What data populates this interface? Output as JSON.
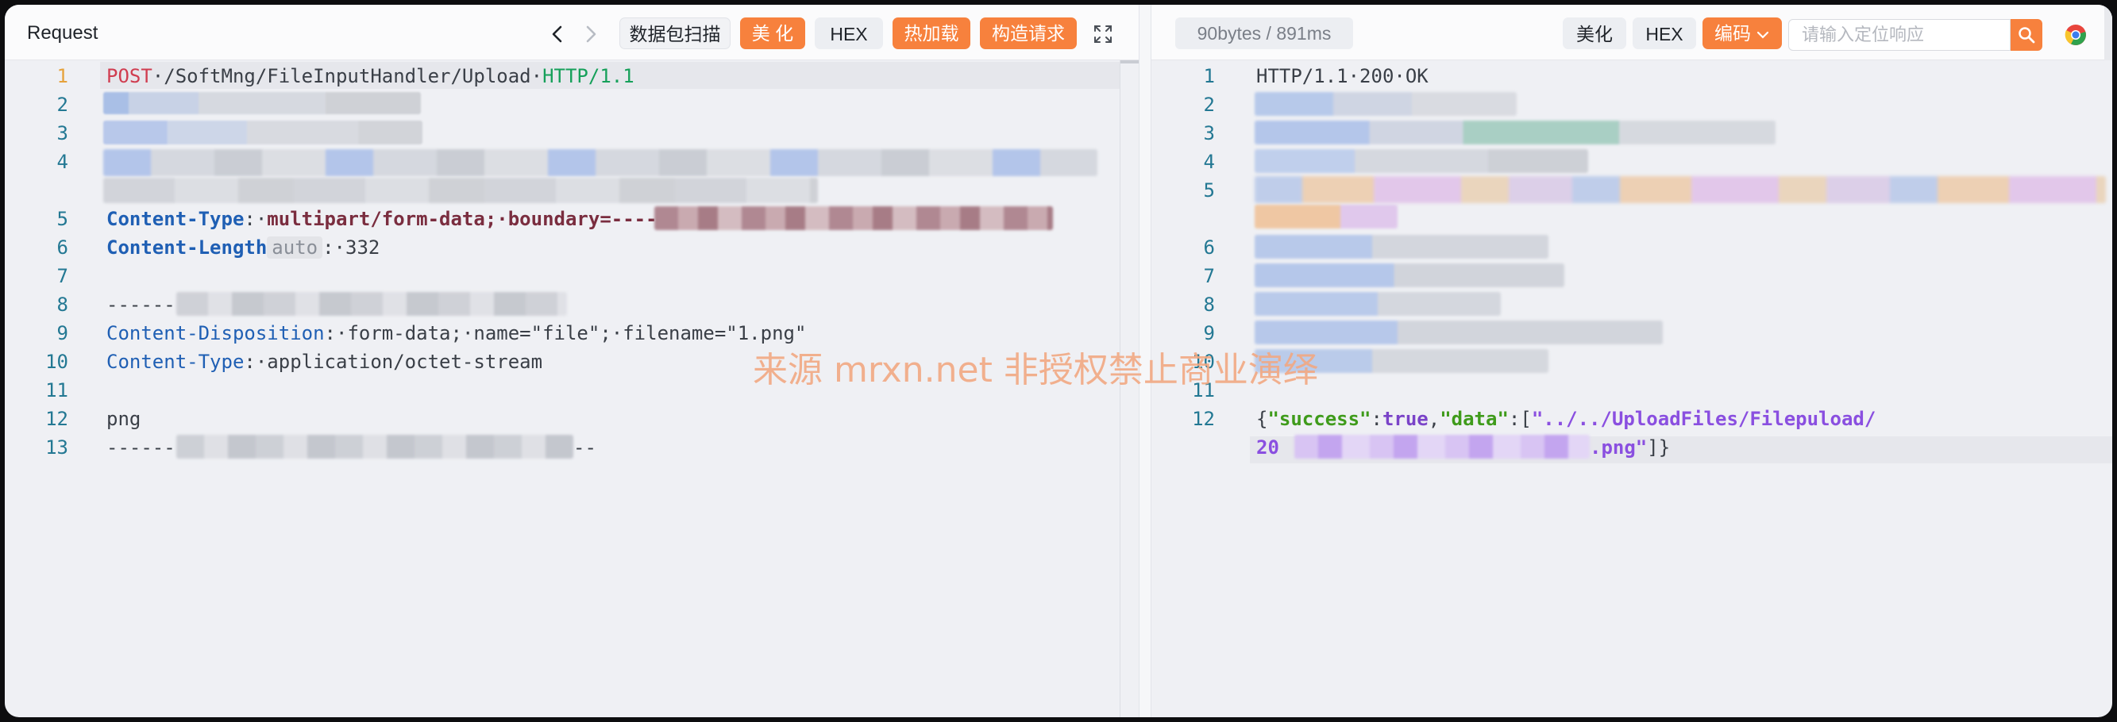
{
  "request": {
    "title": "Request",
    "packet_scan_label": "数据包扫描",
    "beautify_label": "美 化",
    "hex_label": "HEX",
    "hot_load_label": "热加载",
    "build_request_label": "构造请求",
    "lines": [
      {
        "n": "1"
      },
      {
        "n": "2"
      },
      {
        "n": "3"
      },
      {
        "n": "4"
      },
      {
        "n": "5"
      },
      {
        "n": "6"
      },
      {
        "n": "7"
      },
      {
        "n": "8"
      },
      {
        "n": "9"
      },
      {
        "n": "10"
      },
      {
        "n": "11"
      },
      {
        "n": "12"
      },
      {
        "n": "13"
      }
    ],
    "l1_method": "POST",
    "l1_path": "·/SoftMng/FileInputHandler/Upload·",
    "l1_proto": "HTTP/1.1",
    "l5_key": "Content-Type",
    "l5_colon": ":·",
    "l5_value": "multipart/form-data;·boundary=----",
    "l6_key": "Content-Length",
    "l6_auto": "auto",
    "l6_value": ":·332",
    "l8_text": "------",
    "l9_key": "Content-Disposition",
    "l9_value": ":·form-data;·name=\"file\";·filename=\"1.png\"",
    "l10_key": "Content-Type",
    "l10_value": ":·application/octet-stream",
    "l12_text": "png",
    "l13_text": "------",
    "l13_tail": "--"
  },
  "response": {
    "meta": "90bytes / 891ms",
    "beautify_label": "美化",
    "hex_label": "HEX",
    "encoding_label": "编码",
    "search_placeholder": "请输入定位响应",
    "lines": [
      {
        "n": "1"
      },
      {
        "n": "2"
      },
      {
        "n": "3"
      },
      {
        "n": "4"
      },
      {
        "n": "5"
      },
      {
        "n": "6"
      },
      {
        "n": "7"
      },
      {
        "n": "8"
      },
      {
        "n": "9"
      },
      {
        "n": "10"
      },
      {
        "n": "11"
      },
      {
        "n": "12"
      }
    ],
    "l1_text": "HTTP/1.1·200·OK",
    "j_open": "{",
    "j_key1": "\"success\"",
    "j_colon1": ":",
    "j_true": "true",
    "j_comma1": ",",
    "j_key2": "\"data\"",
    "j_colon2": ":[",
    "j_str1": "\"../../UploadFiles/Filepuload/",
    "j_str2_prefix": "20",
    "j_str2_suffix": ".png\"",
    "j_close": "]}"
  },
  "watermark": "来源 mrxn.net 非授权禁止商业演绎",
  "colors": {
    "accent": "#f7813d",
    "line_number": "#237893",
    "method": "#d03d50",
    "protocol": "#16a05a",
    "header_key": "#1f5fb4"
  }
}
